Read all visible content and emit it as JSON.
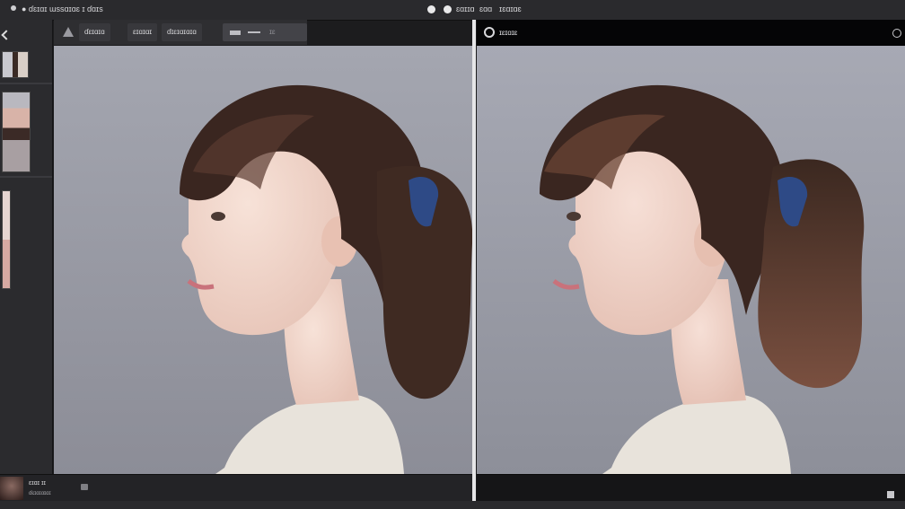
{
  "titlebar": {
    "app_title": "● ɗɛɪɑɪ ɯssɑɪɑɛ ɪ ɗɑɪs",
    "right_label_1": "ɛɑɪɪɑ",
    "right_label_2": "ɛɑɑ",
    "right_label_3": "ɪɛɑɪɑɛ"
  },
  "left_toolbar": {
    "label_1": "ɗɛɪɑɪɑ",
    "label_2": "ɛɪɑɪɑɪ",
    "label_3": "ɗɪɛɪɑɪɑɪɑ",
    "label_4": "ɪɛ"
  },
  "right_header": {
    "label": "ɪɛɪɑɪɛ"
  },
  "status_left": {
    "label_1": "ɛɪɑɪ ɪɪ",
    "label_2": "ɗɛɪɑɪɑɪɑɪ"
  },
  "colors": {
    "accent": "#e6e6e8",
    "view_bg": "#9a9ba5",
    "hair": "#3a2620",
    "scrunchie": "#2e4a86",
    "skin": "#f3d9cf",
    "sweater": "#e8e3db"
  },
  "icons": {
    "app": "app-icon",
    "wedge": "wedge-icon",
    "settings": "settings-icon",
    "grid": "grid-icon"
  }
}
